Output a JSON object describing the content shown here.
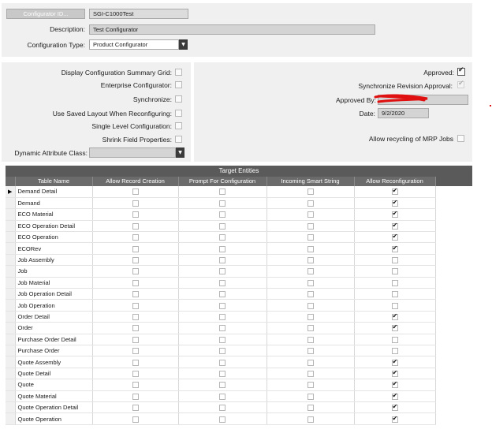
{
  "header": {
    "configurator_id_label": "Configurator ID...",
    "configurator_id_value": "SGI-C1000Test",
    "description_label": "Description:",
    "description_value": "Test Configurator",
    "config_type_label": "Configuration Type:",
    "config_type_value": "Product Configurator"
  },
  "options": {
    "display_summary_grid": {
      "label": "Display Configuration Summary Grid:",
      "checked": false
    },
    "enterprise_configurator": {
      "label": "Enterprise Configurator:",
      "checked": false
    },
    "synchronize": {
      "label": "Synchronize:",
      "checked": false
    },
    "use_saved_layout": {
      "label": "Use Saved Layout When Reconfiguring:",
      "checked": false
    },
    "single_level": {
      "label": "Single Level Configuration:",
      "checked": false
    },
    "shrink_field": {
      "label": "Shrink Field Properties:",
      "checked": false
    },
    "dynamic_attr_label": "Dynamic Attribute Class:",
    "dynamic_attr_value": ""
  },
  "approval": {
    "approved": {
      "label": "Approved:",
      "checked": true
    },
    "sync_revision": {
      "label": "Synchronize Revision Approval:",
      "checked": true
    },
    "approved_by_label": "Approved By:",
    "approved_by_value": "",
    "date_label": "Date:",
    "date_value": "9/2/2020",
    "allow_recycling": {
      "label": "Allow recycling of MRP Jobs",
      "checked": false
    }
  },
  "grid": {
    "title": "Target Entities",
    "selected_indicator": "▶",
    "columns": [
      "Table Name",
      "Allow Record Creation",
      "Prompt For Configuration",
      "Incoming Smart String",
      "Allow Reconfiguration"
    ],
    "rows": [
      {
        "name": "Demand Detail",
        "allow_record_creation": false,
        "prompt_for_configuration": false,
        "incoming_smart_string": false,
        "allow_reconfiguration": true
      },
      {
        "name": "Demand",
        "allow_record_creation": false,
        "prompt_for_configuration": false,
        "incoming_smart_string": false,
        "allow_reconfiguration": true
      },
      {
        "name": "ECO Material",
        "allow_record_creation": false,
        "prompt_for_configuration": false,
        "incoming_smart_string": false,
        "allow_reconfiguration": true
      },
      {
        "name": "ECO Operation Detail",
        "allow_record_creation": false,
        "prompt_for_configuration": false,
        "incoming_smart_string": false,
        "allow_reconfiguration": true
      },
      {
        "name": "ECO Operation",
        "allow_record_creation": false,
        "prompt_for_configuration": false,
        "incoming_smart_string": false,
        "allow_reconfiguration": true
      },
      {
        "name": "ECORev",
        "allow_record_creation": false,
        "prompt_for_configuration": false,
        "incoming_smart_string": false,
        "allow_reconfiguration": true
      },
      {
        "name": "Job Assembly",
        "allow_record_creation": false,
        "prompt_for_configuration": false,
        "incoming_smart_string": false,
        "allow_reconfiguration": false
      },
      {
        "name": "Job",
        "allow_record_creation": false,
        "prompt_for_configuration": false,
        "incoming_smart_string": false,
        "allow_reconfiguration": false
      },
      {
        "name": "Job Material",
        "allow_record_creation": false,
        "prompt_for_configuration": false,
        "incoming_smart_string": false,
        "allow_reconfiguration": false
      },
      {
        "name": "Job Operation Detail",
        "allow_record_creation": false,
        "prompt_for_configuration": false,
        "incoming_smart_string": false,
        "allow_reconfiguration": false
      },
      {
        "name": "Job Operation",
        "allow_record_creation": false,
        "prompt_for_configuration": false,
        "incoming_smart_string": false,
        "allow_reconfiguration": false
      },
      {
        "name": "Order Detail",
        "allow_record_creation": false,
        "prompt_for_configuration": false,
        "incoming_smart_string": false,
        "allow_reconfiguration": true
      },
      {
        "name": "Order",
        "allow_record_creation": false,
        "prompt_for_configuration": false,
        "incoming_smart_string": false,
        "allow_reconfiguration": true
      },
      {
        "name": "Purchase Order Detail",
        "allow_record_creation": false,
        "prompt_for_configuration": false,
        "incoming_smart_string": false,
        "allow_reconfiguration": false
      },
      {
        "name": "Purchase Order",
        "allow_record_creation": false,
        "prompt_for_configuration": false,
        "incoming_smart_string": false,
        "allow_reconfiguration": false
      },
      {
        "name": "Quote Assembly",
        "allow_record_creation": false,
        "prompt_for_configuration": false,
        "incoming_smart_string": false,
        "allow_reconfiguration": true
      },
      {
        "name": "Quote Detail",
        "allow_record_creation": false,
        "prompt_for_configuration": false,
        "incoming_smart_string": false,
        "allow_reconfiguration": true
      },
      {
        "name": "Quote",
        "allow_record_creation": false,
        "prompt_for_configuration": false,
        "incoming_smart_string": false,
        "allow_reconfiguration": true
      },
      {
        "name": "Quote Material",
        "allow_record_creation": false,
        "prompt_for_configuration": false,
        "incoming_smart_string": false,
        "allow_reconfiguration": true
      },
      {
        "name": "Quote Operation Detail",
        "allow_record_creation": false,
        "prompt_for_configuration": false,
        "incoming_smart_string": false,
        "allow_reconfiguration": true
      },
      {
        "name": "Quote Operation",
        "allow_record_creation": false,
        "prompt_for_configuration": false,
        "incoming_smart_string": false,
        "allow_reconfiguration": true
      }
    ]
  },
  "colors": {
    "panel_bg": "#f0f0f0",
    "header_bg": "#6b6b6b",
    "redaction": "#e01010"
  }
}
